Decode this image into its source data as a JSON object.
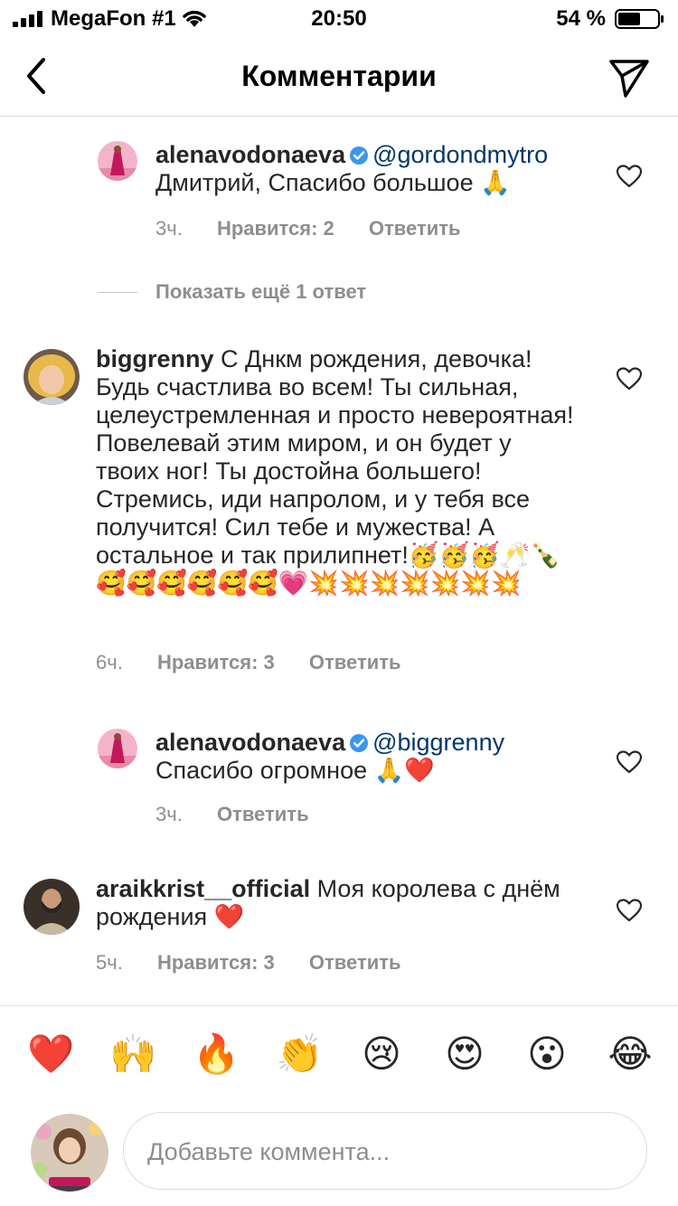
{
  "status_bar": {
    "carrier": "MegaFon #1",
    "time": "20:50",
    "battery": "54 %"
  },
  "header": {
    "title": "Комментарии"
  },
  "comments": [
    {
      "username": "alenavodonaeva",
      "verified": true,
      "mention": "@gordondmytro",
      "text": "Дмитрий, Спасибо большое 🙏",
      "time": "3ч.",
      "likes": "Нравится: 2",
      "reply": "Ответить"
    },
    {
      "username": "biggrenny",
      "text": " С Днкм рождения, девочка! Будь счастлива во всем! Ты сильная, целеустремленная и просто невероятная! Повелевай этим миром, и он будет у твоих ног! Ты достойна большего! Стремись, иди напролом, и у тебя все получится! Сил тебе и мужества! А остальное и так прилипнет!🥳🥳🥳🥂🍾🥰🥰🥰🥰🥰🥰💗💥💥💥💥💥💥💥",
      "time": "6ч.",
      "likes": "Нравится: 3",
      "reply": "Ответить"
    },
    {
      "username": "alenavodonaeva",
      "verified": true,
      "mention": "@biggrenny",
      "text": "Спасибо огромное 🙏❤️",
      "time": "3ч.",
      "reply": "Ответить"
    },
    {
      "username": "araikkrist__official",
      "text": " Моя королева с днём рождения ❤️",
      "time": "5ч.",
      "likes": "Нравится: 3",
      "reply": "Ответить"
    }
  ],
  "show_more_replies": "Показать ещё 1 ответ",
  "emoji_bar": [
    "❤️",
    "🙌",
    "🔥",
    "👏",
    "😢",
    "😍",
    "😮",
    "😂"
  ],
  "comment_input": {
    "placeholder": "Добавьте коммента..."
  },
  "colors": {
    "text": "#262626",
    "secondary": "#8e8e8e",
    "mention": "#00376b",
    "verified": "#3897f0",
    "divider": "#dbdbdb"
  }
}
